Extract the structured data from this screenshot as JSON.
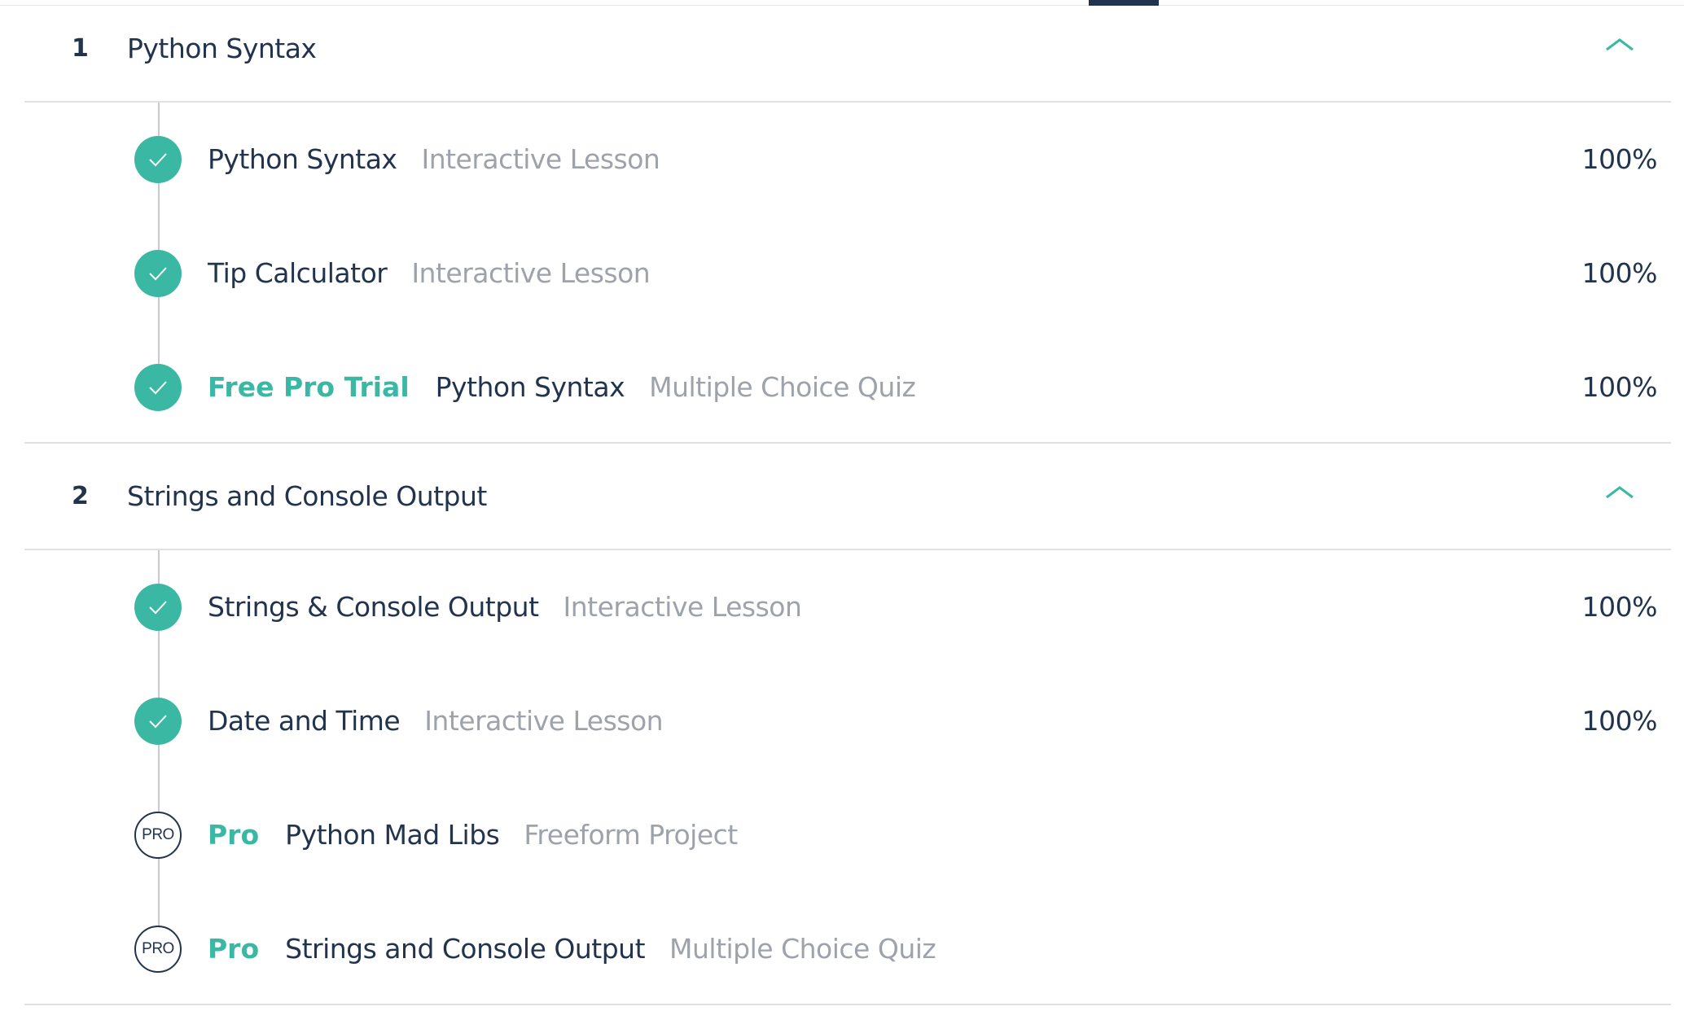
{
  "sections": [
    {
      "number": "1",
      "title": "Python Syntax",
      "items": [
        {
          "badge": "",
          "name": "Python Syntax",
          "kind": "Interactive Lesson",
          "progress": "100%",
          "status": "complete"
        },
        {
          "badge": "",
          "name": "Tip Calculator",
          "kind": "Interactive Lesson",
          "progress": "100%",
          "status": "complete"
        },
        {
          "badge": "Free Pro Trial",
          "name": "Python Syntax",
          "kind": "Multiple Choice Quiz",
          "progress": "100%",
          "status": "complete"
        }
      ]
    },
    {
      "number": "2",
      "title": "Strings and Console Output",
      "items": [
        {
          "badge": "",
          "name": "Strings & Console Output",
          "kind": "Interactive Lesson",
          "progress": "100%",
          "status": "complete"
        },
        {
          "badge": "",
          "name": "Date and Time",
          "kind": "Interactive Lesson",
          "progress": "100%",
          "status": "complete"
        },
        {
          "badge": "Pro",
          "name": "Python Mad Libs",
          "kind": "Freeform Project",
          "progress": "",
          "status": "pro",
          "icon_label": "PRO"
        },
        {
          "badge": "Pro",
          "name": "Strings and Console Output",
          "kind": "Multiple Choice Quiz",
          "progress": "",
          "status": "pro",
          "icon_label": "PRO"
        }
      ]
    }
  ],
  "icons": {
    "complete": "checkmark-icon",
    "collapse": "chevron-up-icon"
  },
  "colors": {
    "accent": "#3bb8a3",
    "text": "#22344d",
    "muted": "#9da2ab",
    "divider": "#dfe1e5"
  }
}
